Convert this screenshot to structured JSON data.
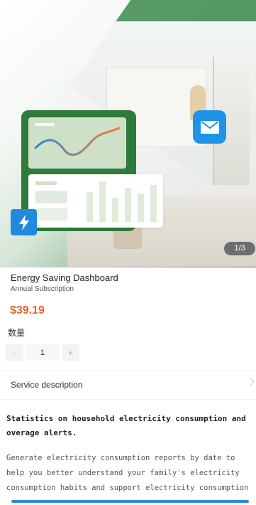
{
  "hero": {
    "page_indicator": "1/3",
    "icons": [
      "bolt-icon",
      "mail-icon"
    ],
    "brand_green": "#2e7b3a",
    "icon_blue": "#1f8ae0"
  },
  "product": {
    "title": "Energy Saving Dashboard",
    "subtitle": "Annual Subscription",
    "price": "$39.19",
    "price_color": "#e8622a"
  },
  "quantity": {
    "label": "数量",
    "decrement": "-",
    "value": "1",
    "increment": "+"
  },
  "service": {
    "label": "Service description",
    "icon": "chevron-right-icon"
  },
  "description": {
    "heading": "Statistics on household electricity consumption and overage alerts.",
    "body": "Generate electricity consumption reports by date to help you better understand your family's electricity consumption habits and support electricity consumption"
  }
}
